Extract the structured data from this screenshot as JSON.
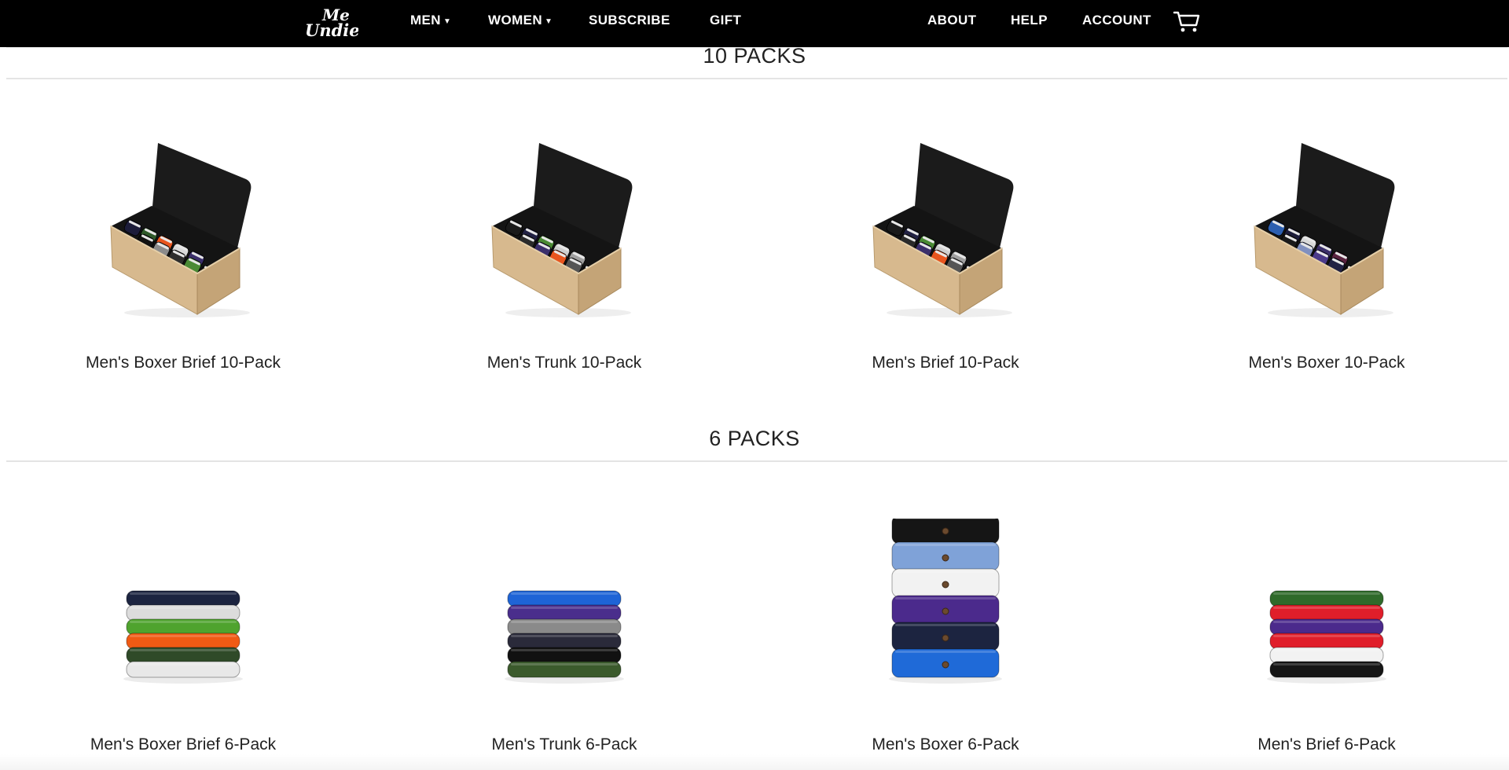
{
  "brand": {
    "logo_text_top": "Me",
    "logo_text_bottom": "Undies"
  },
  "nav": {
    "left": [
      {
        "label": "MEN",
        "dropdown": true
      },
      {
        "label": "WOMEN",
        "dropdown": true
      },
      {
        "label": "SUBSCRIBE",
        "dropdown": false
      },
      {
        "label": "GIFT",
        "dropdown": false
      }
    ],
    "right": [
      {
        "label": "ABOUT"
      },
      {
        "label": "HELP"
      },
      {
        "label": "ACCOUNT"
      }
    ],
    "cart_icon": "cart-icon"
  },
  "sections": [
    {
      "title": "10 PACKS",
      "products": [
        {
          "name": "Men's Boxer Brief 10-Pack",
          "image": "box-icon",
          "colors": [
            "#1c1c3a",
            "#2f5a2a",
            "#e8551e",
            "#d9d9d9",
            "#3b2f6b",
            "#111111",
            "#8b8b8b",
            "#2d2d2d",
            "#4a8a35",
            "#1a1a1a"
          ]
        },
        {
          "name": "Men's Trunk 10-Pack",
          "image": "box-icon",
          "colors": [
            "#1a1a1a",
            "#222244",
            "#4a8a35",
            "#cfcfcf",
            "#a0a0a0",
            "#2a2a2a",
            "#3b2f6b",
            "#e8551e",
            "#555555",
            "#111111"
          ]
        },
        {
          "name": "Men's Brief 10-Pack",
          "image": "box-icon",
          "colors": [
            "#1a1a1a",
            "#222244",
            "#4a8a35",
            "#cfcfcf",
            "#a0a0a0",
            "#2a2a2a",
            "#3b2f6b",
            "#e8551e",
            "#555555",
            "#111111"
          ]
        },
        {
          "name": "Men's Boxer 10-Pack",
          "image": "box-icon",
          "colors": [
            "#2c5fb0",
            "#1c1c3a",
            "#d9d9d9",
            "#3b2f6b",
            "#5a2340",
            "#1a1a1a",
            "#8090c0",
            "#4b3a8a",
            "#222244",
            "#111111"
          ]
        }
      ]
    },
    {
      "title": "6 PACKS",
      "products": [
        {
          "name": "Men's Boxer Brief 6-Pack",
          "image": "stack-icon",
          "colors": [
            "#1c2440",
            "#dcdcdc",
            "#4fa32e",
            "#f05a14",
            "#2f4a28",
            "#e8e8e8"
          ]
        },
        {
          "name": "Men's Trunk 6-Pack",
          "image": "stack-icon",
          "colors": [
            "#1e64d6",
            "#4a2e8c",
            "#8a8a8a",
            "#2a2a3a",
            "#111111",
            "#3b5a2c"
          ]
        },
        {
          "name": "Men's Boxer 6-Pack",
          "image": "stack-icon",
          "colors": [
            "#151515",
            "#7fa2d8",
            "#f2f2f2",
            "#4b2a8c",
            "#1c2440",
            "#1f6ad8"
          ]
        },
        {
          "name": "Men's Brief 6-Pack",
          "image": "stack-icon",
          "colors": [
            "#2f6a2a",
            "#e01e2a",
            "#4b2a8c",
            "#e01e2a",
            "#f2f2f2",
            "#151515"
          ]
        }
      ]
    }
  ]
}
